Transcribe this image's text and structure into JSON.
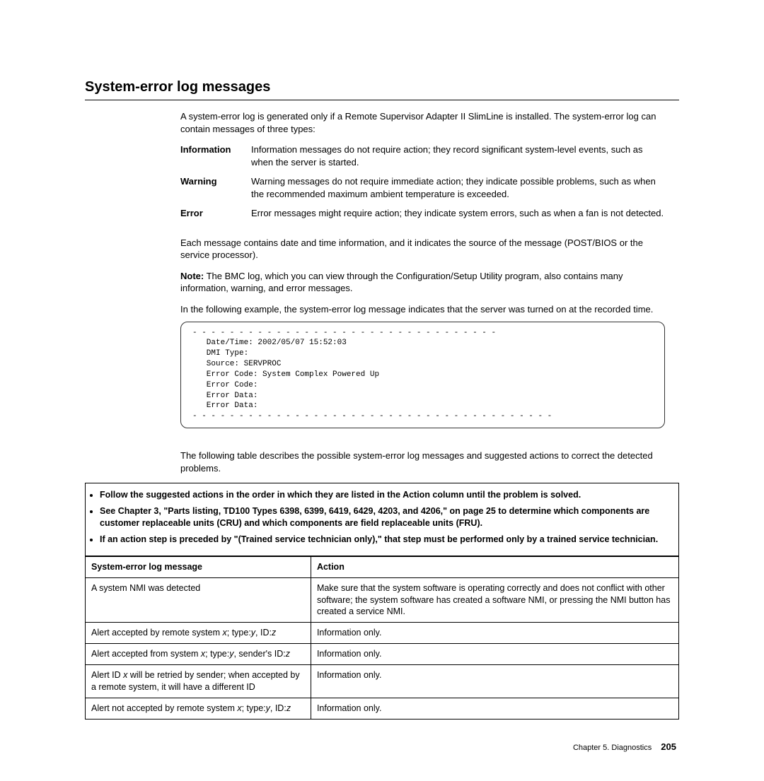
{
  "heading": "System-error log messages",
  "intro": "A system-error log is generated only if a Remote Supervisor Adapter II SlimLine is installed. The system-error log can contain messages of three types:",
  "defs": [
    {
      "term": "Information",
      "desc": "Information messages do not require action; they record significant system-level events, such as when the server is started."
    },
    {
      "term": "Warning",
      "desc": "Warning messages do not require immediate action; they indicate possible problems, such as when the recommended maximum ambient temperature is exceeded."
    },
    {
      "term": "Error",
      "desc": "Error messages might require action; they indicate system errors, such as when a fan is not detected."
    }
  ],
  "para_each": "Each message contains date and time information, and it indicates the source of the message (POST/BIOS or the service processor).",
  "note_label": "Note:",
  "note_body": "  The BMC log, which you can view through the Configuration/Setup Utility program, also contains many information, warning, and error messages.",
  "para_example": "In the following example, the system-error log message indicates that the server was turned on at the recorded time.",
  "code_block": "- - - - - - - - - - - - - - - - - - - - - - - - - - - - - - - - -\n   Date/Time: 2002/05/07 15:52:03\n   DMI Type:\n   Source: SERVPROC\n   Error Code: System Complex Powered Up\n   Error Code:\n   Error Data:\n   Error Data:\n- - - - - - - - - - - - - - - - - - - - - - - - - - - - - - - - - - - - - - -",
  "para_table_intro": "The following table describes the possible system-error log messages and suggested actions to correct the detected problems.",
  "bullets": [
    "Follow the suggested actions in the order in which they are listed in the Action column until the problem is solved.",
    "See Chapter 3, \"Parts listing, TD100 Types 6398, 6399, 6419, 6429, 4203, and 4206,\" on page 25 to determine which components are customer replaceable units (CRU) and which components are field replaceable units (FRU).",
    "If an action step is preceded by \"(Trained service technician only),\" that step must be performed only by a trained service technician."
  ],
  "table": {
    "headers": {
      "msg": "System-error log message",
      "act": "Action"
    },
    "rows": [
      {
        "msg_plain": "A system NMI was detected",
        "act": "Make sure that the system software is operating correctly and does not conflict with other software; the system software has created a software NMI, or pressing the NMI button has created a service NMI."
      },
      {
        "msg_parts": [
          "Alert accepted by remote system ",
          "x",
          "; type:",
          "y",
          ", ID:",
          "z"
        ],
        "act": "Information only."
      },
      {
        "msg_parts": [
          "Alert accepted from system ",
          "x",
          "; type:",
          "y",
          ", sender's ID:",
          "z"
        ],
        "act": "Information only."
      },
      {
        "msg_parts": [
          "Alert ID ",
          "x",
          " will be retried by sender; when accepted by a remote system, it will have a different ID"
        ],
        "act": "Information only."
      },
      {
        "msg_parts": [
          "Alert not accepted by remote system ",
          "x",
          "; type:",
          "y",
          ", ID:",
          "z"
        ],
        "act": "Information only."
      }
    ]
  },
  "footer_chapter": "Chapter 5. Diagnostics",
  "footer_page": "205"
}
